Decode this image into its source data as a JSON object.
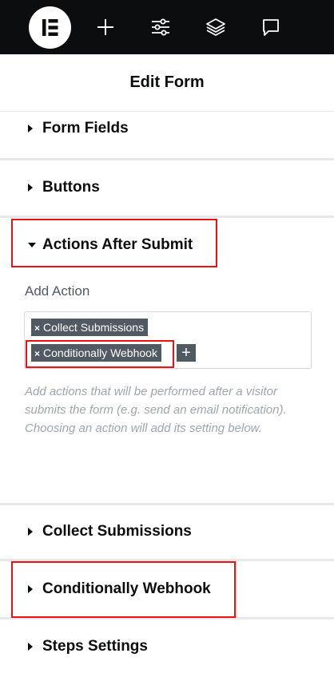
{
  "toolbar": {
    "icons": [
      "elementor-logo-icon",
      "add-icon",
      "settings-sliders-icon",
      "layers-icon",
      "comments-icon"
    ]
  },
  "header": {
    "title": "Edit Form"
  },
  "sections": {
    "form_fields": {
      "label": "Form Fields",
      "expanded": false
    },
    "buttons": {
      "label": "Buttons",
      "expanded": false
    },
    "actions_after_submit": {
      "label": "Actions After Submit",
      "expanded": true,
      "add_action_label": "Add Action",
      "tags": [
        {
          "label": "Collect Submissions",
          "remove": "×"
        },
        {
          "label": "Conditionally Webhook",
          "remove": "×"
        }
      ],
      "add_tag_label": "+",
      "help_text": "Add actions that will be performed after a visitor submits the form (e.g. send an email notification). Choosing an action will add its setting below."
    },
    "collect_submissions": {
      "label": "Collect Submissions",
      "expanded": false
    },
    "conditionally_webhook": {
      "label": "Conditionally Webhook",
      "expanded": false
    },
    "steps_settings": {
      "label": "Steps Settings",
      "expanded": false
    }
  },
  "colors": {
    "toolbar_bg": "#0c0d0e",
    "tag_bg": "#515962",
    "highlight": "#ee1111",
    "divider": "#e6e8ea"
  }
}
